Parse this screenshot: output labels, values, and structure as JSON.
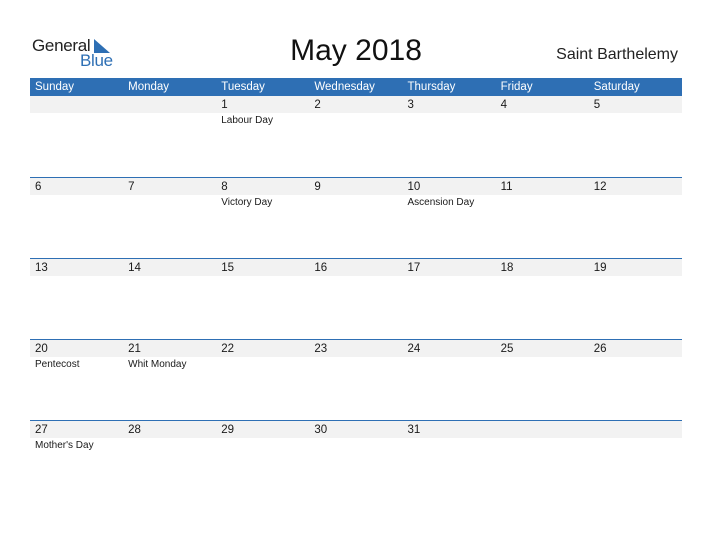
{
  "logo": {
    "word1": "General",
    "word2": "Blue",
    "accent": "#2e6fb4"
  },
  "title": "May 2018",
  "country": "Saint Barthelemy",
  "weekdays": [
    "Sunday",
    "Monday",
    "Tuesday",
    "Wednesday",
    "Thursday",
    "Friday",
    "Saturday"
  ],
  "weeks": [
    [
      {
        "d": "",
        "e": ""
      },
      {
        "d": "",
        "e": ""
      },
      {
        "d": "1",
        "e": "Labour Day"
      },
      {
        "d": "2",
        "e": ""
      },
      {
        "d": "3",
        "e": ""
      },
      {
        "d": "4",
        "e": ""
      },
      {
        "d": "5",
        "e": ""
      }
    ],
    [
      {
        "d": "6",
        "e": ""
      },
      {
        "d": "7",
        "e": ""
      },
      {
        "d": "8",
        "e": "Victory Day"
      },
      {
        "d": "9",
        "e": ""
      },
      {
        "d": "10",
        "e": "Ascension Day"
      },
      {
        "d": "11",
        "e": ""
      },
      {
        "d": "12",
        "e": ""
      }
    ],
    [
      {
        "d": "13",
        "e": ""
      },
      {
        "d": "14",
        "e": ""
      },
      {
        "d": "15",
        "e": ""
      },
      {
        "d": "16",
        "e": ""
      },
      {
        "d": "17",
        "e": ""
      },
      {
        "d": "18",
        "e": ""
      },
      {
        "d": "19",
        "e": ""
      }
    ],
    [
      {
        "d": "20",
        "e": "Pentecost"
      },
      {
        "d": "21",
        "e": "Whit Monday"
      },
      {
        "d": "22",
        "e": ""
      },
      {
        "d": "23",
        "e": ""
      },
      {
        "d": "24",
        "e": ""
      },
      {
        "d": "25",
        "e": ""
      },
      {
        "d": "26",
        "e": ""
      }
    ],
    [
      {
        "d": "27",
        "e": "Mother's Day"
      },
      {
        "d": "28",
        "e": ""
      },
      {
        "d": "29",
        "e": ""
      },
      {
        "d": "30",
        "e": ""
      },
      {
        "d": "31",
        "e": ""
      },
      {
        "d": "",
        "e": ""
      },
      {
        "d": "",
        "e": ""
      }
    ]
  ]
}
